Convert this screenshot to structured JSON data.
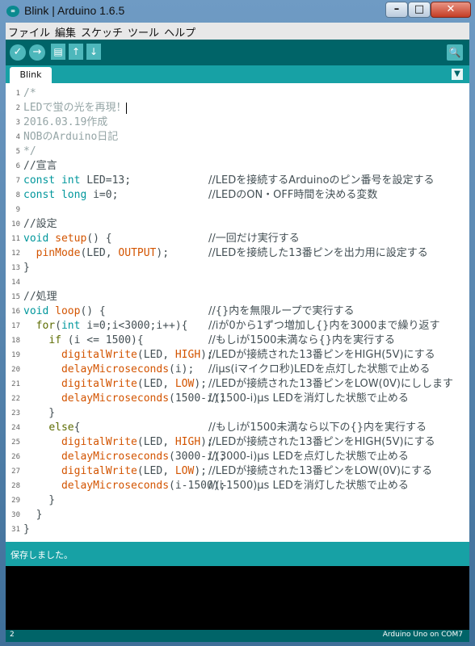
{
  "window": {
    "title": "Blink | Arduino 1.6.5",
    "app_icon": "∞"
  },
  "winbtns": {
    "min": "–",
    "max": "□",
    "close": "✕"
  },
  "menu": [
    "ファイル",
    "編集",
    "スケッチ",
    "ツール",
    "ヘルプ"
  ],
  "toolbar": {
    "verify": "✓",
    "upload": "→",
    "new": "▤",
    "open": "↑",
    "save": "↓",
    "serial": "🔍"
  },
  "tab": {
    "label": "Blink",
    "menu": "▼"
  },
  "code_lines": [
    {
      "n": "1",
      "code": "/*",
      "cm": ""
    },
    {
      "n": "2",
      "code": "LEDで蛍の光を再現！",
      "cm": ""
    },
    {
      "n": "3",
      "code": "2016.03.19作成",
      "cm": ""
    },
    {
      "n": "4",
      "code": "NOBのArduino日記",
      "cm": ""
    },
    {
      "n": "5",
      "code": "*/",
      "cm": ""
    },
    {
      "n": "6",
      "code": "//宣言",
      "cm": ""
    },
    {
      "n": "7",
      "code": "const int LED=13;",
      "cm": "//LEDを接続するArduinoのピン番号を設定する"
    },
    {
      "n": "8",
      "code": "const long i=0;",
      "cm": "//LEDのON・OFF時間を決める変数"
    },
    {
      "n": "9",
      "code": "",
      "cm": ""
    },
    {
      "n": "10",
      "code": "//設定",
      "cm": ""
    },
    {
      "n": "11",
      "code": "void setup() {",
      "cm": "//一回だけ実行する"
    },
    {
      "n": "12",
      "code": "  pinMode(LED, OUTPUT);",
      "cm": "//LEDを接続した13番ピンを出力用に設定する"
    },
    {
      "n": "13",
      "code": "}",
      "cm": ""
    },
    {
      "n": "14",
      "code": "",
      "cm": ""
    },
    {
      "n": "15",
      "code": "//処理",
      "cm": ""
    },
    {
      "n": "16",
      "code": "void loop() {",
      "cm": "//{}内を無限ループで実行する"
    },
    {
      "n": "17",
      "code": "  for(int i=0;i<3000;i++){",
      "cm": "//iが0から1ずつ増加し{}内を3000まで繰り返す"
    },
    {
      "n": "18",
      "code": "    if (i <= 1500){",
      "cm": "//もしiが1500未満なら{}内を実行する"
    },
    {
      "n": "19",
      "code": "      digitalWrite(LED, HIGH);",
      "cm": "//LEDが接続された13番ピンをHIGH(5V)にする"
    },
    {
      "n": "20",
      "code": "      delayMicroseconds(i);",
      "cm": "//iμs(iマイクロ秒)LEDを点灯した状態で止める"
    },
    {
      "n": "21",
      "code": "      digitalWrite(LED, LOW);",
      "cm": "//LEDが接続された13番ピンをLOW(0V)にしします"
    },
    {
      "n": "22",
      "code": "      delayMicroseconds(1500-i);",
      "cm": "//(1500-i)μs LEDを消灯した状態で止める"
    },
    {
      "n": "23",
      "code": "    }",
      "cm": ""
    },
    {
      "n": "24",
      "code": "    else{",
      "cm": "//もしiが1500未満なら以下の{}内を実行する"
    },
    {
      "n": "25",
      "code": "      digitalWrite(LED, HIGH);",
      "cm": "//LEDが接続された13番ピンをHIGH(5V)にする"
    },
    {
      "n": "26",
      "code": "      delayMicroseconds(3000-i);",
      "cm": "//(3000-i)μs LEDを点灯した状態で止める"
    },
    {
      "n": "27",
      "code": "      digitalWrite(LED, LOW);",
      "cm": "//LEDが接続された13番ピンをLOW(0V)にする"
    },
    {
      "n": "28",
      "code": "      delayMicroseconds(i-1500);",
      "cm": "//(i-1500)μs LEDを消灯した状態で止める"
    },
    {
      "n": "29",
      "code": "    }",
      "cm": ""
    },
    {
      "n": "30",
      "code": "  }",
      "cm": ""
    },
    {
      "n": "31",
      "code": "}",
      "cm": ""
    }
  ],
  "status": {
    "message": "保存しました。"
  },
  "bottom": {
    "line": "2",
    "board": "Arduino Uno on COM7"
  }
}
